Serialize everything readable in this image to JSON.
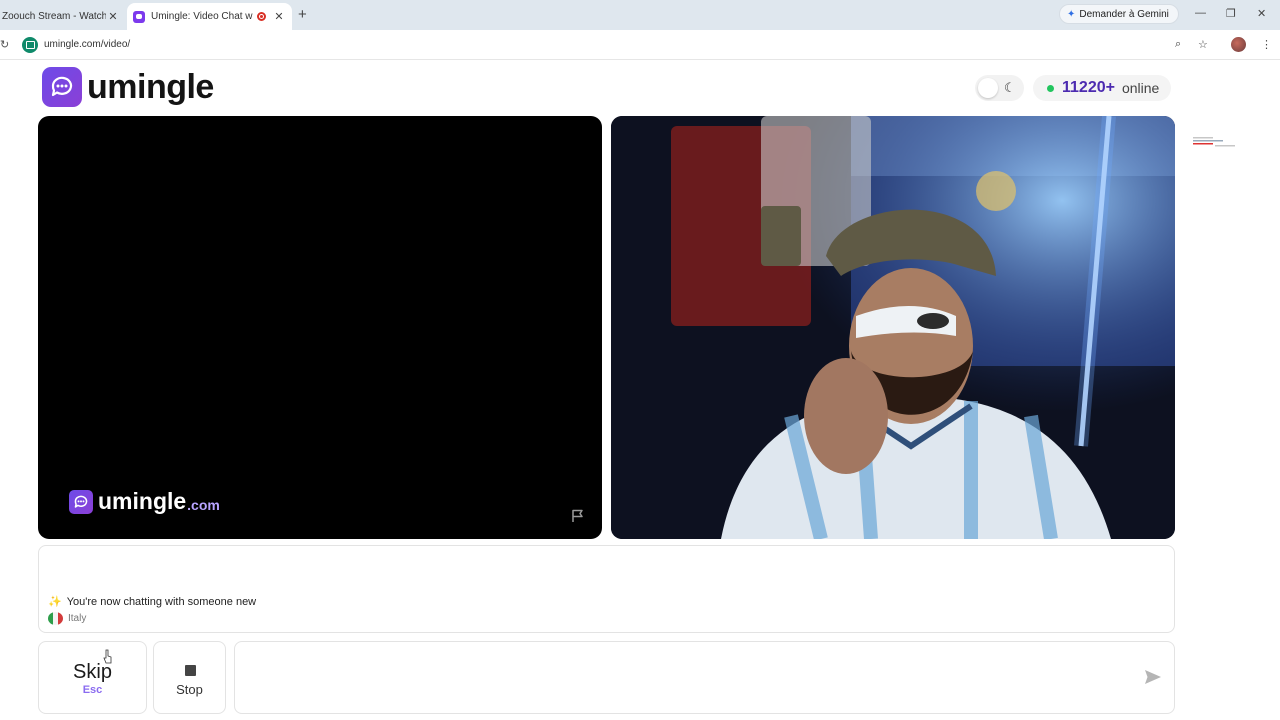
{
  "browser": {
    "tabs": [
      {
        "title": "Zoouch Stream - Watch Li",
        "active": false
      },
      {
        "title": "Umingle: Video Chat with S",
        "active": true
      }
    ],
    "gemini_button": "Demander à Gemini",
    "url": "umingle.com/video/"
  },
  "header": {
    "logo_text": "umingle",
    "online_count": "11220+",
    "online_label": "online"
  },
  "local_video": {
    "watermark_name": "umingle",
    "watermark_suffix": ".com"
  },
  "chat": {
    "system_message": "You're now chatting with someone new",
    "country": "Italy",
    "message_placeholder": ""
  },
  "controls": {
    "skip_label": "Skip",
    "skip_key": "Esc",
    "stop_label": "Stop"
  },
  "colors": {
    "brand": "#7c3aed",
    "online_dot": "#22c55e",
    "online_count": "#4c2bb0"
  }
}
